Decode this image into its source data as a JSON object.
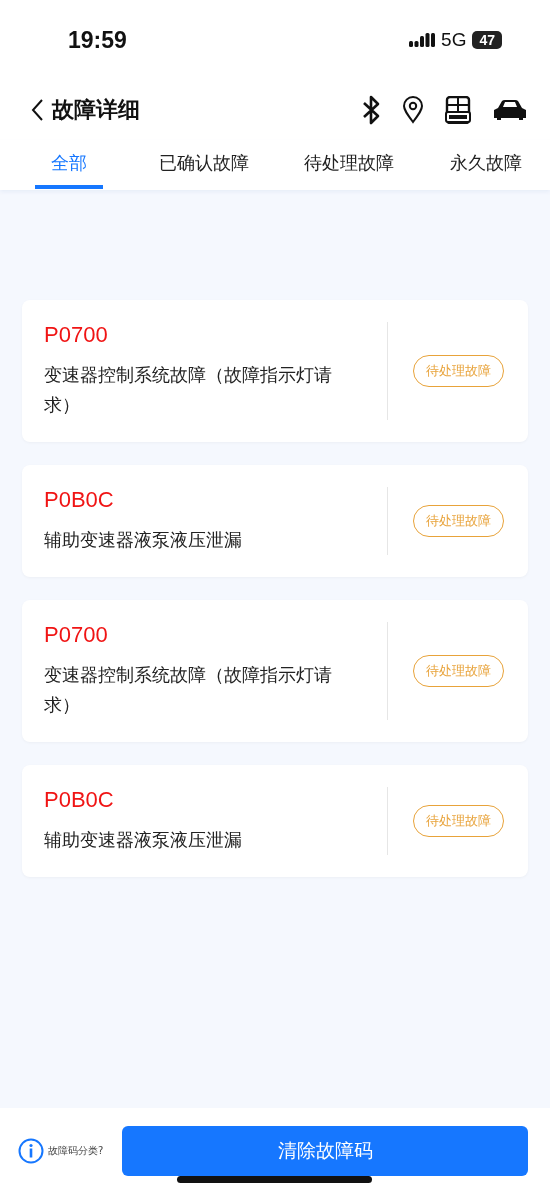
{
  "status_bar": {
    "time": "19:59",
    "network": "5G",
    "battery": "47"
  },
  "header": {
    "title": "故障详细"
  },
  "tabs": [
    {
      "label": "全部",
      "selected": true
    },
    {
      "label": "已确认故障",
      "selected": false
    },
    {
      "label": "待处理故障",
      "selected": false
    },
    {
      "label": "永久故障",
      "selected": false
    }
  ],
  "faults": [
    {
      "code": "P0700",
      "description": "变速器控制系统故障（故障指示灯请求）",
      "status": "待处理故障"
    },
    {
      "code": "P0B0C",
      "description": "辅助变速器液泵液压泄漏",
      "status": "待处理故障"
    },
    {
      "code": "P0700",
      "description": "变速器控制系统故障（故障指示灯请求）",
      "status": "待处理故障"
    },
    {
      "code": "P0B0C",
      "description": "辅助变速器液泵液压泄漏",
      "status": "待处理故障"
    }
  ],
  "footer": {
    "help_link": "故障码分类?",
    "button": "清除故障码"
  }
}
